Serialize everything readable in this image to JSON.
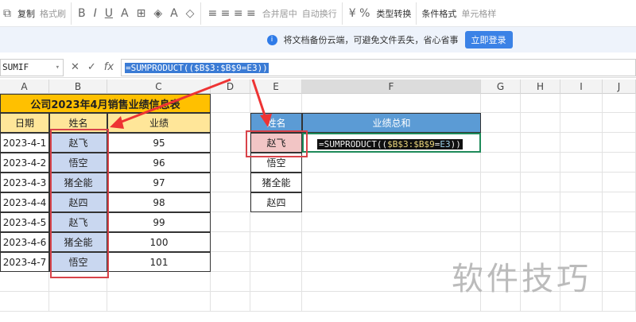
{
  "toolbar": {
    "copy": "复制",
    "format_painter": "格式刷",
    "merge_center": "合并居中",
    "wrap": "自动换行",
    "type_convert": "类型转换",
    "cond_format": "条件格式",
    "cell_style": "单元格样"
  },
  "notice": {
    "text": "将文档备份云端，可避免文件丢失，省心省事",
    "button": "立即登录"
  },
  "formula_bar": {
    "name_box": "SUMIF",
    "formula": "=SUMPRODUCT(($B$3:$B$9=E3))"
  },
  "columns": [
    "A",
    "B",
    "C",
    "D",
    "E",
    "F",
    "G",
    "H",
    "I",
    "J"
  ],
  "table": {
    "title": "公司2023年4月销售业绩信息表",
    "headers": [
      "日期",
      "姓名",
      "业绩"
    ],
    "rows": [
      [
        "2023-4-1",
        "赵飞",
        "95"
      ],
      [
        "2023-4-2",
        "悟空",
        "96"
      ],
      [
        "2023-4-3",
        "猪全能",
        "97"
      ],
      [
        "2023-4-4",
        "赵四",
        "98"
      ],
      [
        "2023-4-5",
        "赵飞",
        "99"
      ],
      [
        "2023-4-6",
        "猪全能",
        "100"
      ],
      [
        "2023-4-7",
        "悟空",
        "101"
      ]
    ]
  },
  "lookup": {
    "headers": [
      "姓名",
      "业绩总和"
    ],
    "names": [
      "赵飞",
      "悟空",
      "猪全能",
      "赵四"
    ],
    "f_prefix": "=SUMPRODUCT((",
    "f_range": "$B$3:$B$9",
    "f_eq": "=",
    "f_ref": "E3",
    "f_suffix": "))"
  },
  "watermark": "软件技巧"
}
